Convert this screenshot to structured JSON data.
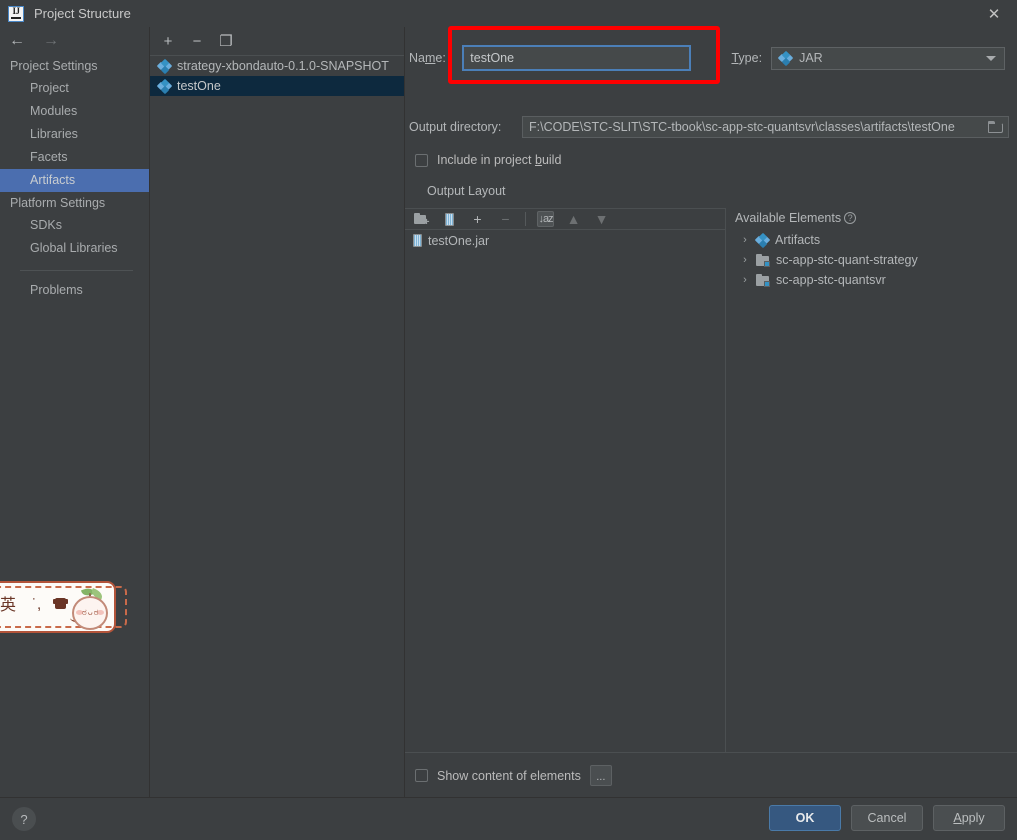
{
  "window": {
    "title": "Project Structure",
    "app_icon": "intellij-idea-icon",
    "close_label": "✕"
  },
  "nav": {
    "back_label": "←",
    "forward_label": "→",
    "sections": [
      {
        "title": "Project Settings",
        "items": [
          {
            "label": "Project",
            "selected": false
          },
          {
            "label": "Modules",
            "selected": false
          },
          {
            "label": "Libraries",
            "selected": false
          },
          {
            "label": "Facets",
            "selected": false
          },
          {
            "label": "Artifacts",
            "selected": true
          }
        ]
      },
      {
        "title": "Platform Settings",
        "items": [
          {
            "label": "SDKs",
            "selected": false
          },
          {
            "label": "Global Libraries",
            "selected": false
          }
        ]
      }
    ],
    "extra_items": [
      {
        "label": "Problems",
        "selected": false
      }
    ]
  },
  "artifact_list": {
    "toolbar": [
      {
        "name": "add-artifact-button",
        "glyph": "+"
      },
      {
        "name": "remove-artifact-button",
        "glyph": "−"
      },
      {
        "name": "copy-artifact-button",
        "glyph": "❐"
      }
    ],
    "items": [
      {
        "label": "strategy-xbondauto-0.1.0-SNAPSHOT",
        "icon": "artifact-icon",
        "selected": false
      },
      {
        "label": "testOne",
        "icon": "artifact-icon",
        "selected": true
      }
    ]
  },
  "detail": {
    "name_label": "Name:",
    "name_value": "testOne",
    "type_label": "Type:",
    "type_value": "JAR",
    "type_icon": "artifact-icon",
    "output_directory_label": "Output directory:",
    "output_directory_value": "F:\\CODE\\STC-SLIT\\STC-tbook\\sc-app-stc-quantsvr\\classes\\artifacts\\testOne",
    "browse_icon": "folder-icon",
    "include_in_build_label": "Include in project build",
    "include_in_build_checked": false,
    "output_layout_label": "Output Layout",
    "layout_toolbar": [
      {
        "name": "create-directory-button",
        "icon": "new-folder-icon",
        "state": "enabled"
      },
      {
        "name": "create-archive-button",
        "icon": "jar-icon",
        "state": "enabled"
      },
      {
        "name": "add-copy-of-button",
        "icon": "plus-dropdown-icon",
        "glyph": "+",
        "state": "enabled"
      },
      {
        "name": "remove-element-button",
        "icon": "minus-icon",
        "glyph": "−",
        "state": "disabled"
      },
      {
        "name": "sort-elements-button",
        "icon": "sort-az-icon",
        "glyph": "↓az",
        "state": "active"
      },
      {
        "name": "move-up-button",
        "icon": "arrow-up-icon",
        "glyph": "▲",
        "state": "disabled"
      },
      {
        "name": "move-down-button",
        "icon": "arrow-down-icon",
        "glyph": "▼",
        "state": "disabled"
      }
    ],
    "layout_tree": [
      {
        "label": "testOne.jar",
        "icon": "jar-icon"
      }
    ],
    "available_elements": {
      "header": "Available Elements",
      "help_glyph": "?",
      "items": [
        {
          "label": "Artifacts",
          "icon": "artifact-icon",
          "chevron": "›"
        },
        {
          "label": "sc-app-stc-quant-strategy",
          "icon": "module-icon",
          "chevron": "›"
        },
        {
          "label": "sc-app-stc-quantsvr",
          "icon": "module-icon",
          "chevron": "›"
        }
      ]
    },
    "show_content_label": "Show content of elements",
    "show_content_checked": false,
    "ellipsis_label": "..."
  },
  "footer": {
    "help_glyph": "?",
    "ok_label": "OK",
    "cancel_label": "Cancel",
    "apply_label": "Apply"
  },
  "ime_bar": {
    "mode_label": "英",
    "punctuation_label": "˙,",
    "keyboard_icon": "keyboard-icon",
    "mascot_face": "ಠᴗಠ"
  },
  "annotation": {
    "color": "#fe0000",
    "target": "name-field"
  }
}
